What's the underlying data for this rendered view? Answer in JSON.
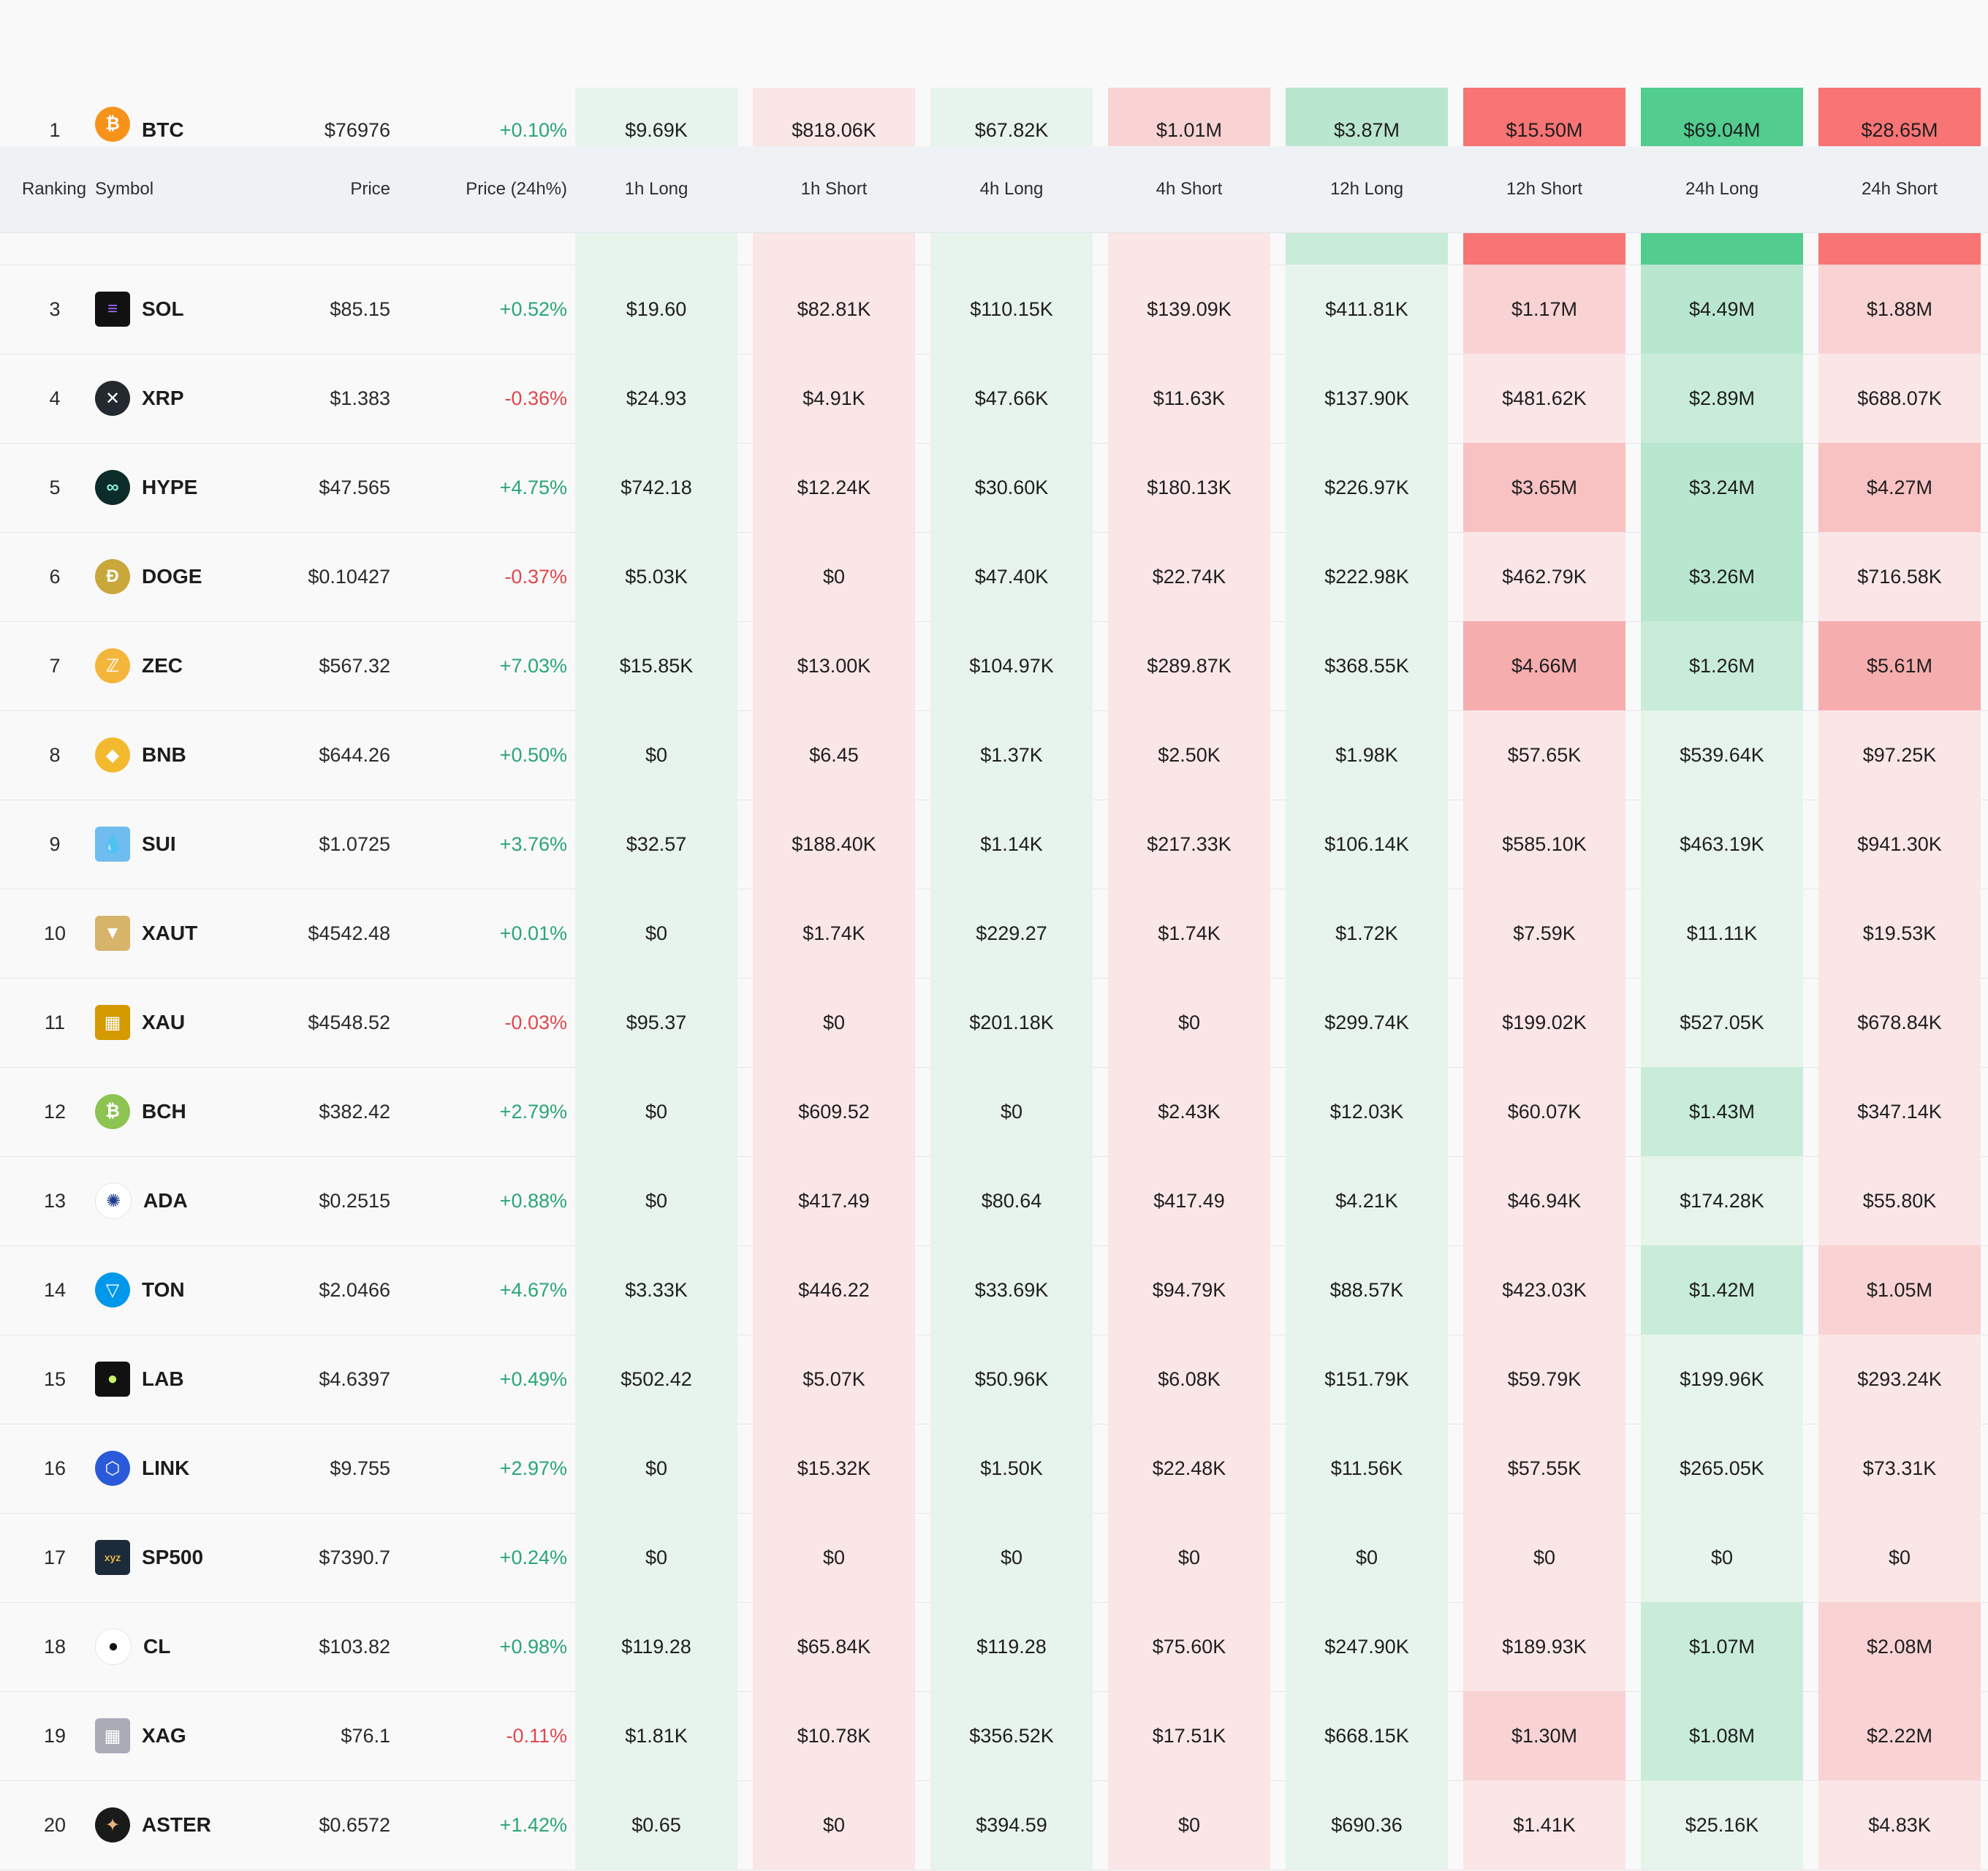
{
  "header": {
    "ranking": "Ranking",
    "symbol": "Symbol",
    "price": "Price",
    "price_change": "Price (24h%)",
    "h1_long": "1h Long",
    "h1_short": "1h Short",
    "h4_long": "4h Long",
    "h4_short": "4h Short",
    "h12_long": "12h Long",
    "h12_short": "12h Short",
    "h24_long": "24h Long",
    "h24_short": "24h Short"
  },
  "colors": {
    "long_light": "#e6f4ec",
    "long_mid": "#c8ecd9",
    "long_strong": "#52cc8f",
    "short_light": "#fbe6e7",
    "short_mid": "#f8c2c3",
    "short_strong": "#f87475",
    "positive_text": "#2aa676",
    "negative_text": "#e0474c"
  },
  "rows": [
    {
      "rank": "1",
      "symbol": "BTC",
      "icon": "bitcoin-icon",
      "price": "$76976",
      "change": "+0.10%",
      "values": [
        "$9.69K",
        "$818.06K",
        "$67.82K",
        "$1.01M",
        "$3.87M",
        "$15.50M",
        "$69.04M",
        "$28.65M"
      ]
    },
    {
      "rank": "3",
      "symbol": "SOL",
      "icon": "solana-icon",
      "price": "$85.15",
      "change": "+0.52%",
      "values": [
        "$19.60",
        "$82.81K",
        "$110.15K",
        "$139.09K",
        "$411.81K",
        "$1.17M",
        "$4.49M",
        "$1.88M"
      ]
    },
    {
      "rank": "4",
      "symbol": "XRP",
      "icon": "xrp-icon",
      "price": "$1.383",
      "change": "-0.36%",
      "values": [
        "$24.93",
        "$4.91K",
        "$47.66K",
        "$11.63K",
        "$137.90K",
        "$481.62K",
        "$2.89M",
        "$688.07K"
      ]
    },
    {
      "rank": "5",
      "symbol": "HYPE",
      "icon": "hyperliquid-icon",
      "price": "$47.565",
      "change": "+4.75%",
      "values": [
        "$742.18",
        "$12.24K",
        "$30.60K",
        "$180.13K",
        "$226.97K",
        "$3.65M",
        "$3.24M",
        "$4.27M"
      ]
    },
    {
      "rank": "6",
      "symbol": "DOGE",
      "icon": "dogecoin-icon",
      "price": "$0.10427",
      "change": "-0.37%",
      "values": [
        "$5.03K",
        "$0",
        "$47.40K",
        "$22.74K",
        "$222.98K",
        "$462.79K",
        "$3.26M",
        "$716.58K"
      ]
    },
    {
      "rank": "7",
      "symbol": "ZEC",
      "icon": "zcash-icon",
      "price": "$567.32",
      "change": "+7.03%",
      "values": [
        "$15.85K",
        "$13.00K",
        "$104.97K",
        "$289.87K",
        "$368.55K",
        "$4.66M",
        "$1.26M",
        "$5.61M"
      ]
    },
    {
      "rank": "8",
      "symbol": "BNB",
      "icon": "bnb-icon",
      "price": "$644.26",
      "change": "+0.50%",
      "values": [
        "$0",
        "$6.45",
        "$1.37K",
        "$2.50K",
        "$1.98K",
        "$57.65K",
        "$539.64K",
        "$97.25K"
      ]
    },
    {
      "rank": "9",
      "symbol": "SUI",
      "icon": "sui-icon",
      "price": "$1.0725",
      "change": "+3.76%",
      "values": [
        "$32.57",
        "$188.40K",
        "$1.14K",
        "$217.33K",
        "$106.14K",
        "$585.10K",
        "$463.19K",
        "$941.30K"
      ]
    },
    {
      "rank": "10",
      "symbol": "XAUT",
      "icon": "tether-gold-icon",
      "price": "$4542.48",
      "change": "+0.01%",
      "values": [
        "$0",
        "$1.74K",
        "$229.27",
        "$1.74K",
        "$1.72K",
        "$7.59K",
        "$11.11K",
        "$19.53K"
      ]
    },
    {
      "rank": "11",
      "symbol": "XAU",
      "icon": "gold-bars-icon",
      "price": "$4548.52",
      "change": "-0.03%",
      "values": [
        "$95.37",
        "$0",
        "$201.18K",
        "$0",
        "$299.74K",
        "$199.02K",
        "$527.05K",
        "$678.84K"
      ]
    },
    {
      "rank": "12",
      "symbol": "BCH",
      "icon": "bitcoin-cash-icon",
      "price": "$382.42",
      "change": "+2.79%",
      "values": [
        "$0",
        "$609.52",
        "$0",
        "$2.43K",
        "$12.03K",
        "$60.07K",
        "$1.43M",
        "$347.14K"
      ]
    },
    {
      "rank": "13",
      "symbol": "ADA",
      "icon": "cardano-icon",
      "price": "$0.2515",
      "change": "+0.88%",
      "values": [
        "$0",
        "$417.49",
        "$80.64",
        "$417.49",
        "$4.21K",
        "$46.94K",
        "$174.28K",
        "$55.80K"
      ]
    },
    {
      "rank": "14",
      "symbol": "TON",
      "icon": "toncoin-icon",
      "price": "$2.0466",
      "change": "+4.67%",
      "values": [
        "$3.33K",
        "$446.22",
        "$33.69K",
        "$94.79K",
        "$88.57K",
        "$423.03K",
        "$1.42M",
        "$1.05M"
      ]
    },
    {
      "rank": "15",
      "symbol": "LAB",
      "icon": "lab-icon",
      "price": "$4.6397",
      "change": "+0.49%",
      "values": [
        "$502.42",
        "$5.07K",
        "$50.96K",
        "$6.08K",
        "$151.79K",
        "$59.79K",
        "$199.96K",
        "$293.24K"
      ]
    },
    {
      "rank": "16",
      "symbol": "LINK",
      "icon": "chainlink-icon",
      "price": "$9.755",
      "change": "+2.97%",
      "values": [
        "$0",
        "$15.32K",
        "$1.50K",
        "$22.48K",
        "$11.56K",
        "$57.55K",
        "$265.05K",
        "$73.31K"
      ]
    },
    {
      "rank": "17",
      "symbol": "SP500",
      "icon": "xyz-icon",
      "price": "$7390.7",
      "change": "+0.24%",
      "values": [
        "$0",
        "$0",
        "$0",
        "$0",
        "$0",
        "$0",
        "$0",
        "$0"
      ]
    },
    {
      "rank": "18",
      "symbol": "CL",
      "icon": "oil-drop-icon",
      "price": "$103.82",
      "change": "+0.98%",
      "values": [
        "$119.28",
        "$65.84K",
        "$119.28",
        "$75.60K",
        "$247.90K",
        "$189.93K",
        "$1.07M",
        "$2.08M"
      ]
    },
    {
      "rank": "19",
      "symbol": "XAG",
      "icon": "silver-bars-icon",
      "price": "$76.1",
      "change": "-0.11%",
      "values": [
        "$1.81K",
        "$10.78K",
        "$356.52K",
        "$17.51K",
        "$668.15K",
        "$1.30M",
        "$1.08M",
        "$2.22M"
      ]
    },
    {
      "rank": "20",
      "symbol": "ASTER",
      "icon": "aster-icon",
      "price": "$0.6572",
      "change": "+1.42%",
      "values": [
        "$0.65",
        "$0",
        "$394.59",
        "$0",
        "$690.36",
        "$1.41K",
        "$25.16K",
        "$4.83K"
      ]
    }
  ]
}
